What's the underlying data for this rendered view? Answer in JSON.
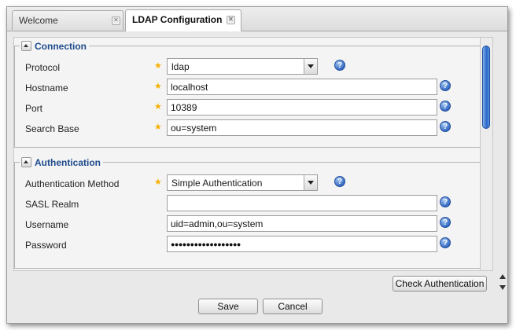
{
  "tabs": [
    {
      "label": "Welcome",
      "active": false
    },
    {
      "label": "LDAP Configuration",
      "active": true
    }
  ],
  "sections": {
    "connection": {
      "title": "Connection",
      "fields": {
        "protocol": {
          "label": "Protocol",
          "value": "ldap",
          "required": true
        },
        "hostname": {
          "label": "Hostname",
          "value": "localhost",
          "required": true
        },
        "port": {
          "label": "Port",
          "value": "10389",
          "required": true
        },
        "search_base": {
          "label": "Search Base",
          "value": "ou=system",
          "required": true
        }
      }
    },
    "authentication": {
      "title": "Authentication",
      "fields": {
        "method": {
          "label": "Authentication Method",
          "value": "Simple Authentication",
          "required": true
        },
        "sasl_realm": {
          "label": "SASL Realm",
          "value": ""
        },
        "username": {
          "label": "Username",
          "value": "uid=admin,ou=system"
        },
        "password": {
          "label": "Password",
          "value": "●●●●●●●●●●●●●●●●●●"
        }
      }
    }
  },
  "required_marker": "★",
  "help_glyph": "?",
  "buttons": {
    "check_auth": "Check Authentication",
    "save": "Save",
    "cancel": "Cancel"
  },
  "icons": {
    "tab_close": "close-icon",
    "collapse": "collapse-arrow-icon",
    "help": "help-icon",
    "required": "required-star-icon"
  },
  "colors": {
    "section_title": "#1d4a8c",
    "required_star": "#f5b000",
    "help_icon": "#2f66c2",
    "scroll_thumb": "#2a66c8"
  }
}
